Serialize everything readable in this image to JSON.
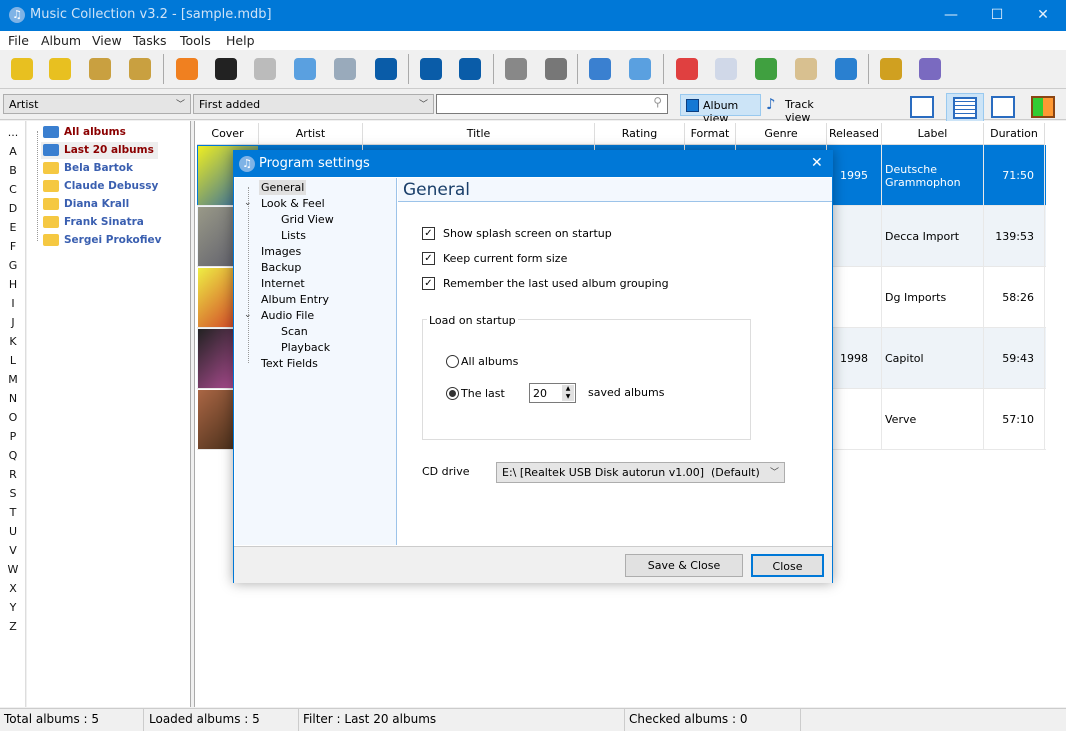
{
  "window": {
    "title": "Music Collection v3.2 - [sample.mdb]",
    "icon": "music-note-icon"
  },
  "menu": [
    "File",
    "Album",
    "View",
    "Tasks",
    "Tools",
    "Help"
  ],
  "toolbar": {
    "icons": [
      "add-database-icon",
      "open-database-icon",
      "database-lifebuoy-icon",
      "restore-database-icon",
      "eject-icon",
      "cd-text-icon",
      "download-icon",
      "add-search-icon",
      "find-duplicates-icon",
      "add-album-icon",
      "delete-album-icon",
      "edit-album-icon",
      "print-icon",
      "html-print-icon",
      "search-table-icon",
      "search-music-icon",
      "calendar-checklist-icon",
      "document-icon",
      "pie-chart-icon",
      "archive-icon",
      "user-icon",
      "settings-icon",
      "exit-icon"
    ]
  },
  "filterbar": {
    "group_by": "Artist",
    "sort_by": "First added",
    "search_value": "",
    "album_view": "Album view",
    "track_view": "Track view"
  },
  "alphabet": [
    "...",
    "A",
    "B",
    "C",
    "D",
    "E",
    "F",
    "G",
    "H",
    "I",
    "J",
    "K",
    "L",
    "M",
    "N",
    "O",
    "P",
    "Q",
    "R",
    "S",
    "T",
    "U",
    "V",
    "W",
    "X",
    "Y",
    "Z"
  ],
  "tree": [
    {
      "label": "All albums",
      "type": "special"
    },
    {
      "label": "Last 20 albums",
      "type": "special",
      "selected": true
    },
    {
      "label": "Bela Bartok"
    },
    {
      "label": "Claude Debussy"
    },
    {
      "label": "Diana Krall"
    },
    {
      "label": "Frank Sinatra"
    },
    {
      "label": "Sergei Prokofiev"
    }
  ],
  "grid": {
    "columns": [
      "Cover",
      "Artist",
      "Title",
      "Rating",
      "Format",
      "Genre",
      "Released",
      "Label",
      "Duration"
    ],
    "rows": [
      {
        "released": "1995",
        "label": "Deutsche Grammophon",
        "duration": "71:50",
        "selected": true
      },
      {
        "released": "",
        "label": "Decca Import",
        "duration": "139:53"
      },
      {
        "released": "",
        "label": "Dg Imports",
        "duration": "58:26"
      },
      {
        "released": "1998",
        "label": "Capitol",
        "duration": "59:43"
      },
      {
        "released": "",
        "label": "Verve",
        "duration": "57:10"
      }
    ]
  },
  "dialog": {
    "title": "Program settings",
    "close": "✕",
    "tree": [
      {
        "label": "General",
        "level": 0,
        "selected": true
      },
      {
        "label": "Look & Feel",
        "level": 0,
        "expanded": true
      },
      {
        "label": "Grid View",
        "level": 1
      },
      {
        "label": "Lists",
        "level": 1
      },
      {
        "label": "Images",
        "level": 0
      },
      {
        "label": "Backup",
        "level": 0
      },
      {
        "label": "Internet",
        "level": 0
      },
      {
        "label": "Album Entry",
        "level": 0
      },
      {
        "label": "Audio File",
        "level": 0,
        "expanded": true
      },
      {
        "label": "Scan",
        "level": 1
      },
      {
        "label": "Playback",
        "level": 1
      },
      {
        "label": "Text Fields",
        "level": 0
      }
    ],
    "section_title": "General",
    "checkboxes": [
      {
        "label": "Show splash screen on startup",
        "checked": true
      },
      {
        "label": "Keep current form size",
        "checked": true
      },
      {
        "label": "Remember the last used album grouping",
        "checked": true
      }
    ],
    "load_group": "Load on startup",
    "radio_all": "All albums",
    "radio_last": "The last",
    "radio_selected": "last",
    "last_count": "20",
    "saved_albums": "saved albums",
    "cd_drive_label": "CD drive",
    "cd_drive_value": "E:\\ [Realtek USB Disk autorun v1.00]  (Default)",
    "save_close": "Save & Close",
    "close_btn": "Close"
  },
  "status": {
    "total": "Total albums : 5",
    "loaded": "Loaded albums : 5",
    "filter": "Filter : Last 20 albums",
    "checked": "Checked albums : 0"
  }
}
